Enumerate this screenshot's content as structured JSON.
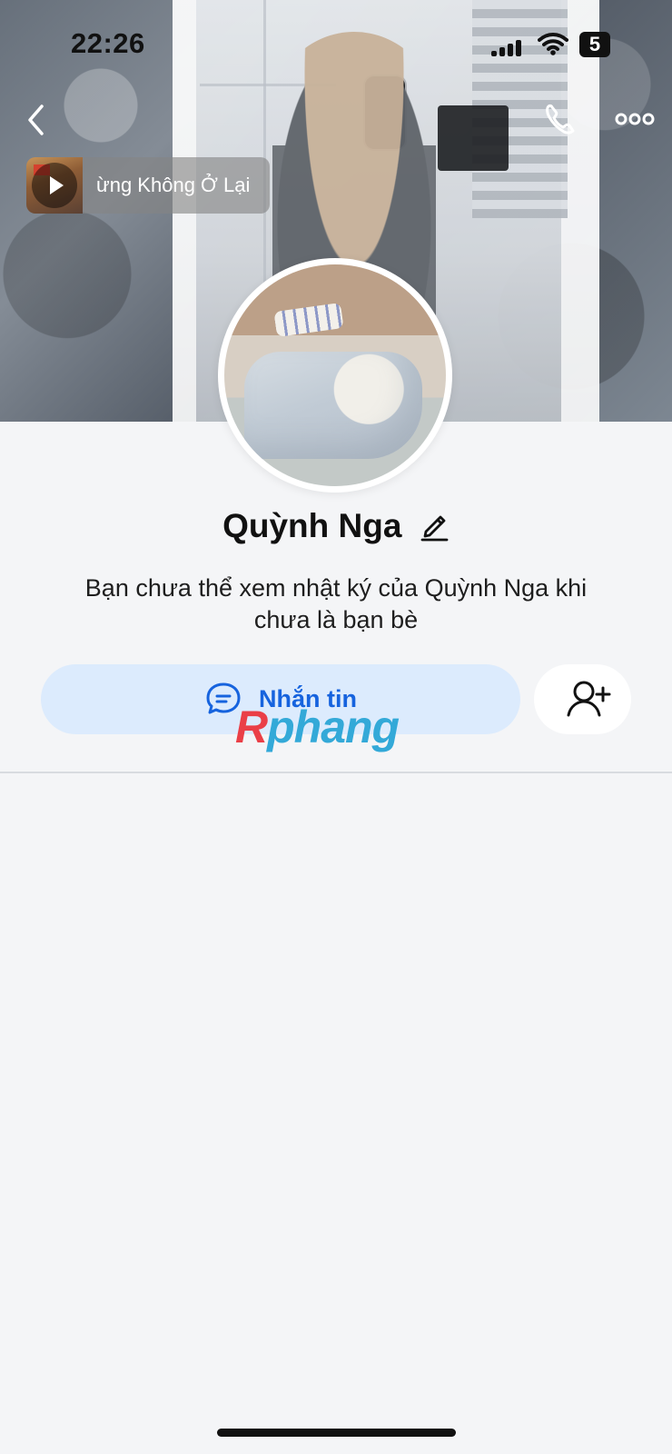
{
  "status_bar": {
    "time": "22:26",
    "battery_level": "5"
  },
  "icons": {
    "back": "back-icon",
    "phone": "phone-icon",
    "more": "more-icon",
    "play": "play-icon",
    "edit": "edit-icon",
    "message": "message-icon",
    "add_friend": "add-friend-icon"
  },
  "music": {
    "title": "ừng Không Ở Lại"
  },
  "profile": {
    "name": "Quỳnh Nga",
    "privacy_message": "Bạn chưa thể xem nhật ký của Quỳnh Nga khi chưa là bạn bè"
  },
  "actions": {
    "message_label": "Nhắn tin"
  },
  "watermark": {
    "first_letter": "R",
    "rest": "phang"
  },
  "colors": {
    "accent": "#1663de",
    "action_bg": "#dcebfd",
    "page_bg": "#f4f5f7"
  }
}
